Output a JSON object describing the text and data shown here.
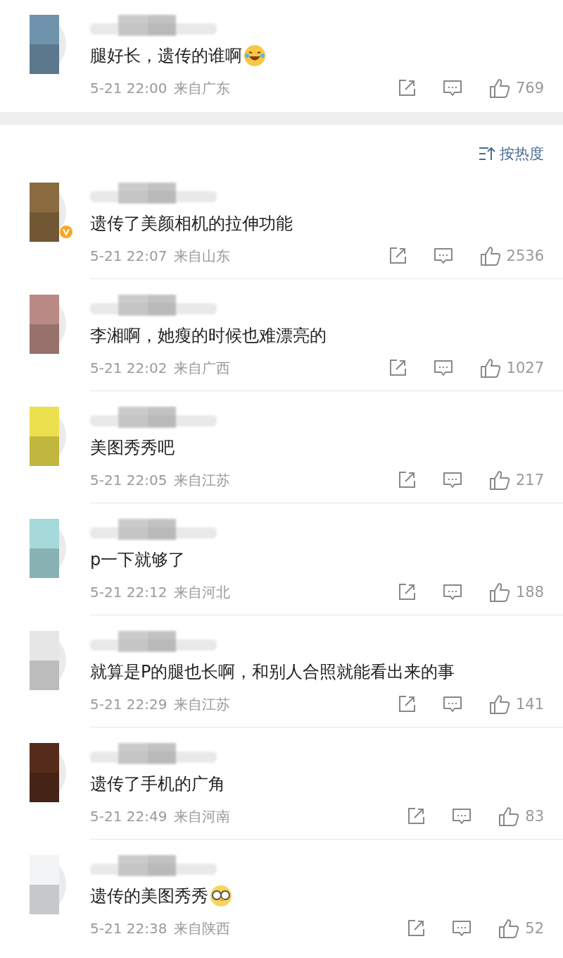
{
  "pinned_comment": {
    "color": "#6f93ad",
    "verified": false,
    "kind": "laugh_emoji",
    "text": "腿好长，遗传的谁啊",
    "time": "5-21 22:00",
    "location": "来自广东",
    "likes": "769"
  },
  "sort": {
    "label": "按热度"
  },
  "comments": [
    {
      "color": "#8a6b40",
      "verified": true,
      "kind": "plain",
      "text": "遗传了美颜相机的拉伸功能",
      "time": "5-21 22:07",
      "location": "来自山东",
      "likes": "2536"
    },
    {
      "color": "#b98a84",
      "verified": false,
      "kind": "plain",
      "text": "李湘啊，她瘦的时候也难漂亮的",
      "time": "5-21 22:02",
      "location": "来自广西",
      "likes": "1027"
    },
    {
      "color": "#ece04e",
      "verified": false,
      "kind": "plain",
      "text": "美图秀秀吧",
      "time": "5-21 22:05",
      "location": "来自江苏",
      "likes": "217"
    },
    {
      "color": "#a6d9d9",
      "verified": false,
      "kind": "plain",
      "text": "p一下就够了",
      "time": "5-21 22:12",
      "location": "来自河北",
      "likes": "188"
    },
    {
      "color": "#e6e6e6",
      "verified": false,
      "kind": "plain",
      "text": "就算是P的腿也长啊，和别人合照就能看出来的事",
      "time": "5-21 22:29",
      "location": "来自江苏",
      "likes": "141"
    },
    {
      "color": "#552b1c",
      "verified": false,
      "kind": "plain",
      "text": "遗传了手机的广角",
      "time": "5-21 22:49",
      "location": "来自河南",
      "likes": "83"
    },
    {
      "color": "#f2f4f6",
      "verified": false,
      "kind": "glasses_emoji",
      "text": "遗传的美图秀秀",
      "time": "5-21 22:38",
      "location": "来自陕西",
      "likes": "52"
    }
  ]
}
